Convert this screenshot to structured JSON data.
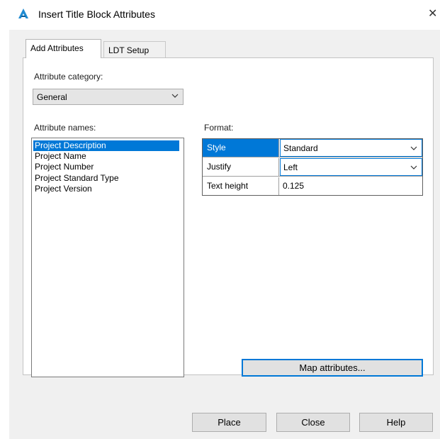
{
  "window": {
    "title": "Insert Title Block Attributes",
    "close_glyph": "✕",
    "app_icon": "autodesk-a-icon",
    "accent_color": "#0078d7"
  },
  "tabs": [
    {
      "label": "Add Attributes",
      "active": true
    },
    {
      "label": "LDT Setup",
      "active": false
    }
  ],
  "attribute_category": {
    "label": "Attribute category:",
    "value": "General"
  },
  "attribute_names": {
    "label": "Attribute names:",
    "items": [
      "Project Description",
      "Project Name",
      "Project Number",
      "Project Standard Type",
      "Project Version"
    ],
    "selected": "Project Description"
  },
  "format": {
    "label": "Format:",
    "rows": [
      {
        "key": "Style",
        "value": "Standard",
        "type": "dropdown",
        "selected": true
      },
      {
        "key": "Justify",
        "value": "Left",
        "type": "dropdown",
        "selected": false
      },
      {
        "key": "Text height",
        "value": "0.125",
        "type": "text",
        "selected": false
      }
    ]
  },
  "buttons": {
    "map_attributes": "Map attributes...",
    "place": "Place",
    "close": "Close",
    "help": "Help"
  }
}
